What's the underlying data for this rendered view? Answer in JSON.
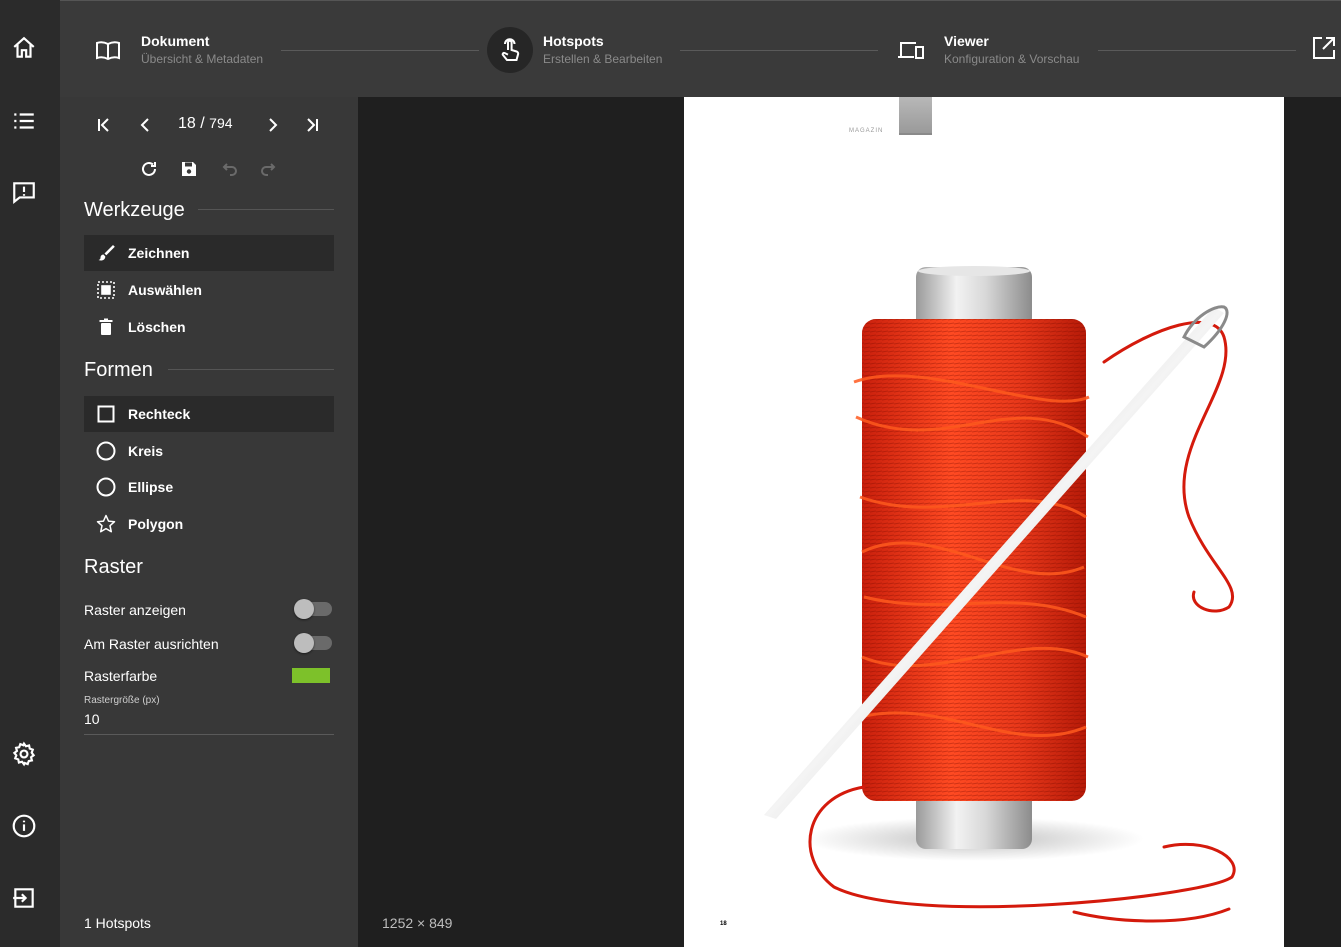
{
  "stepper": {
    "steps": [
      {
        "title": "Dokument",
        "subtitle": "Übersicht & Metadaten",
        "icon": "book-icon"
      },
      {
        "title": "Hotspots",
        "subtitle": "Erstellen & Bearbeiten",
        "icon": "touch-icon"
      },
      {
        "title": "Viewer",
        "subtitle": "Konfiguration & Vorschau",
        "icon": "devices-icon"
      }
    ],
    "active_step": 1
  },
  "rail": {
    "top_icons": [
      "home-icon",
      "list-icon",
      "feedback-icon"
    ],
    "bottom_icons": [
      "settings-icon",
      "info-icon",
      "logout-icon"
    ]
  },
  "pager": {
    "current": "18",
    "separator": "/",
    "total": "794"
  },
  "tools": {
    "title": "Werkzeuge",
    "items": [
      {
        "label": "Zeichnen",
        "icon": "brush-icon",
        "selected": true
      },
      {
        "label": "Auswählen",
        "icon": "select-icon",
        "selected": false
      },
      {
        "label": "Löschen",
        "icon": "trash-icon",
        "selected": false
      }
    ]
  },
  "shapes": {
    "title": "Formen",
    "items": [
      {
        "label": "Rechteck",
        "icon": "square-icon",
        "selected": true
      },
      {
        "label": "Kreis",
        "icon": "circle-icon",
        "selected": false
      },
      {
        "label": "Ellipse",
        "icon": "circle-icon",
        "selected": false
      },
      {
        "label": "Polygon",
        "icon": "star-icon",
        "selected": false
      }
    ]
  },
  "grid": {
    "title": "Raster",
    "show_label": "Raster anzeigen",
    "show_value": false,
    "snap_label": "Am Raster ausrichten",
    "snap_value": false,
    "color_label": "Rasterfarbe",
    "color_value": "#7dc12a",
    "size_label": "Rastergröße (px)",
    "size_value": "10"
  },
  "footer": {
    "hotspot_count": "1 Hotspots",
    "dimensions": "1252 × 849"
  },
  "page": {
    "header_label": "MAGAZIN",
    "page_number": "18"
  },
  "colors": {
    "rail_bg": "#2b2b2b",
    "panel_bg": "#383838",
    "topbar_bg": "#3a3a3a",
    "canvas_bg": "#1f1f1f",
    "thread_red": "#e23a1a"
  }
}
